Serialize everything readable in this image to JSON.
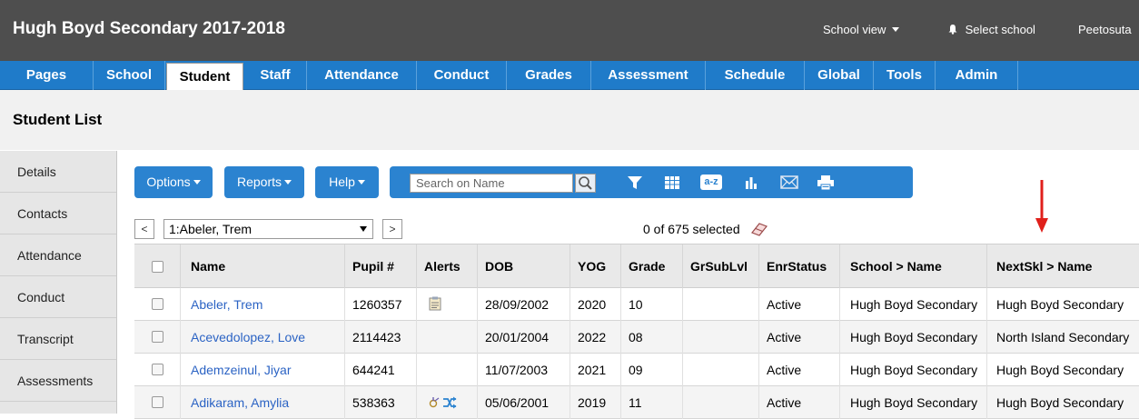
{
  "app": {
    "title": "Hugh Boyd Secondary 2017-2018",
    "school_view": "School view",
    "select_school": "Select school",
    "user": "Peetosuta"
  },
  "tabs": [
    "Pages",
    "School",
    "Student",
    "Staff",
    "Attendance",
    "Conduct",
    "Grades",
    "Assessment",
    "Schedule",
    "Global",
    "Tools",
    "Admin"
  ],
  "active_tab": "Student",
  "page_title": "Student List",
  "sidebar": {
    "items": [
      "Details",
      "Contacts",
      "Attendance",
      "Conduct",
      "Transcript",
      "Assessments"
    ]
  },
  "toolbar": {
    "options_label": "Options",
    "reports_label": "Reports",
    "help_label": "Help",
    "search_placeholder": "Search on Name",
    "icons": [
      "filter-icon",
      "grid-icon",
      "sort-az-icon",
      "chart-icon",
      "mail-icon",
      "print-icon"
    ],
    "az_text": "a-z"
  },
  "record_nav": {
    "prev": "<",
    "next": ">",
    "current": "1:Abeler, Trem",
    "selected_text": "0 of 675 selected"
  },
  "table": {
    "headers": [
      "Name",
      "Pupil #",
      "Alerts",
      "DOB",
      "YOG",
      "Grade",
      "GrSubLvl",
      "EnrStatus",
      "School > Name",
      "NextSkl > Name"
    ],
    "rows": [
      {
        "name": "Abeler, Trem",
        "pupil": "1260357",
        "alert": "note",
        "dob": "28/09/2002",
        "yog": "2020",
        "grade": "10",
        "grsub": "",
        "status": "Active",
        "school": "Hugh Boyd Secondary",
        "next": "Hugh Boyd Secondary"
      },
      {
        "name": "Acevedolopez, Love",
        "pupil": "2114423",
        "alert": "",
        "dob": "20/01/2004",
        "yog": "2022",
        "grade": "08",
        "grsub": "",
        "status": "Active",
        "school": "Hugh Boyd Secondary",
        "next": "North Island Secondary"
      },
      {
        "name": "Ademzeinul, Jiyar",
        "pupil": "644241",
        "alert": "",
        "dob": "11/07/2003",
        "yog": "2021",
        "grade": "09",
        "grsub": "",
        "status": "Active",
        "school": "Hugh Boyd Secondary",
        "next": "Hugh Boyd Secondary"
      },
      {
        "name": "Adikaram, Amylia",
        "pupil": "538363",
        "alert": "medical-transfer",
        "dob": "05/06/2001",
        "yog": "2019",
        "grade": "11",
        "grsub": "",
        "status": "Active",
        "school": "Hugh Boyd Secondary",
        "next": "Hugh Boyd Secondary"
      }
    ]
  },
  "colors": {
    "topbar": "#4e4e4e",
    "navbar": "#1f7bc9",
    "link": "#2b63c4",
    "arrow": "#e0201b"
  }
}
